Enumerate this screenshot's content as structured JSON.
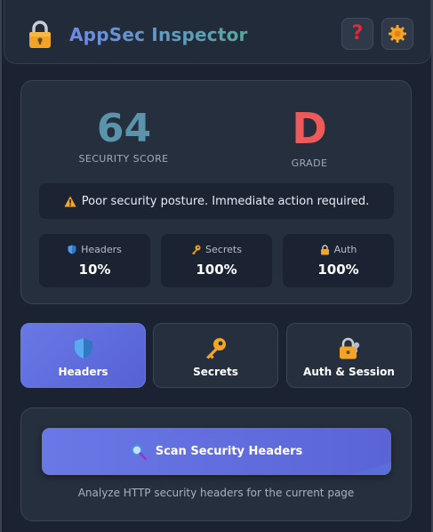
{
  "header": {
    "title": "AppSec Inspector",
    "help_glyph": "?",
    "icons": {
      "logo": "lock-icon",
      "help": "help-icon",
      "settings": "settings-icon"
    }
  },
  "score": {
    "value": "64",
    "label": "SECURITY SCORE",
    "grade": "D",
    "grade_label": "GRADE",
    "alert": "Poor security posture. Immediate action required.",
    "metrics": [
      {
        "label": "Headers",
        "value": "10%",
        "icon": "shield-icon"
      },
      {
        "label": "Secrets",
        "value": "100%",
        "icon": "key-icon"
      },
      {
        "label": "Auth",
        "value": "100%",
        "icon": "lock-icon"
      }
    ]
  },
  "tabs": [
    {
      "label": "Headers",
      "icon": "shield-icon",
      "active": true
    },
    {
      "label": "Secrets",
      "icon": "key-icon",
      "active": false
    },
    {
      "label": "Auth & Session",
      "icon": "lock-icon",
      "active": false
    }
  ],
  "scan": {
    "button_label": "Scan Security Headers",
    "hint": "Analyze HTTP security headers for the current page",
    "icon": "search-icon"
  },
  "colors": {
    "accent": "#6a78e6",
    "score": "#5b93ab",
    "grade": "#ee5a5a",
    "warning": "#f5a524"
  }
}
